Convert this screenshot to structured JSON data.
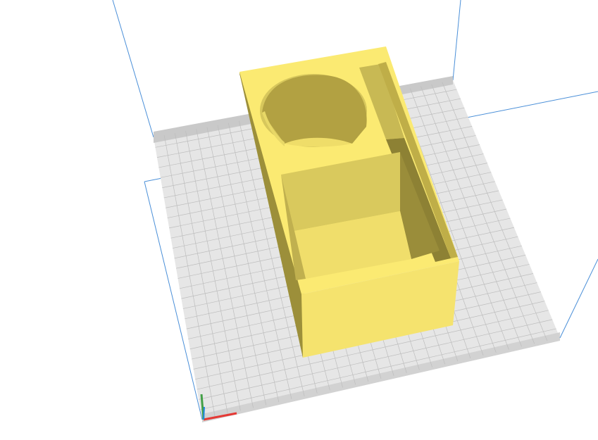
{
  "app": {
    "view": "3d-print-preparation-viewport",
    "model_color": "#f7e46f",
    "build_plate_color": "#e6e6e6",
    "build_plate_edge_color": "#c3c3c3",
    "grid_line_color": "#bdbdbd",
    "build_volume_line_color": "#4a8fd8"
  },
  "axes": {
    "x_color": "#e53935",
    "y_color": "#43a047",
    "z_color": "#1e88e5"
  },
  "model": {
    "name": "box-with-cylindrical-and-square-compartments",
    "compartments": [
      "cylindrical-cup",
      "square-pocket",
      "narrow-slot"
    ]
  }
}
